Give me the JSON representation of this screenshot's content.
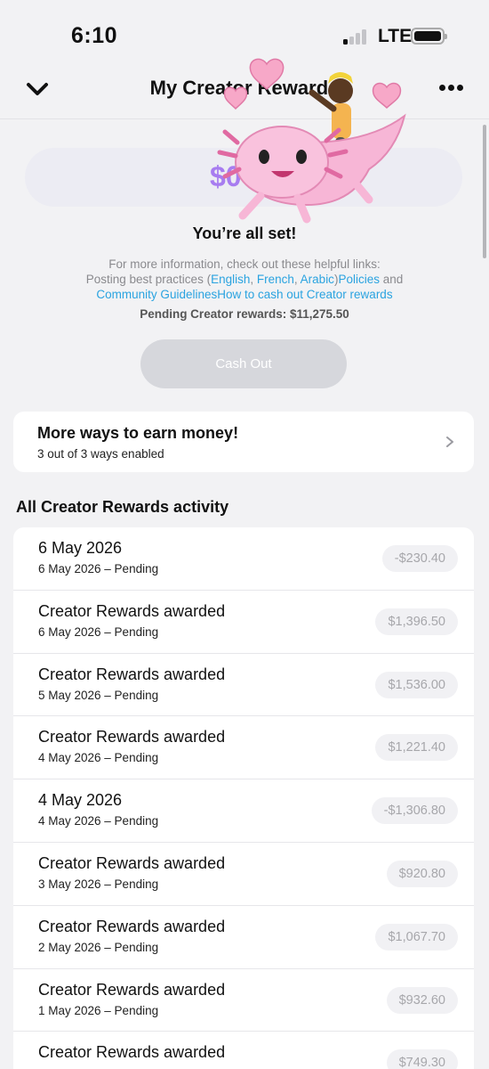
{
  "status_bar": {
    "time": "6:10",
    "network": "LTE"
  },
  "header": {
    "title": "My Creator Rewards"
  },
  "balance": {
    "value": "$0"
  },
  "status_message": "You’re all set!",
  "info": {
    "line1": "For more information, check out these helpful links:",
    "practices_prefix": "Posting best practices (",
    "link_english": "English",
    "sep1": ", ",
    "link_french": "French",
    "sep2": ", ",
    "link_arabic": "Arabic",
    "close_paren": ")",
    "link_policies": "Policies",
    "and_text": " and",
    "link_guidelines": "Community Guidelines",
    "link_cash_out": "How to cash out Creator rewards"
  },
  "pending_total": "Pending Creator rewards: $11,275.50",
  "cash_out_label": "Cash Out",
  "earn_card": {
    "title": "More ways to earn money!",
    "subtitle": "3 out of 3 ways enabled"
  },
  "activity": {
    "title": "All Creator Rewards activity",
    "items": [
      {
        "title": "6 May 2026",
        "subtitle": "6 May 2026 – Pending",
        "amount": "-$230.40"
      },
      {
        "title": "Creator Rewards awarded",
        "subtitle": "6 May 2026 – Pending",
        "amount": "$1,396.50"
      },
      {
        "title": "Creator Rewards awarded",
        "subtitle": "5 May 2026 – Pending",
        "amount": "$1,536.00"
      },
      {
        "title": "Creator Rewards awarded",
        "subtitle": "4 May 2026 – Pending",
        "amount": "$1,221.40"
      },
      {
        "title": "4 May 2026",
        "subtitle": "4 May 2026 – Pending",
        "amount": "-$1,306.80"
      },
      {
        "title": "Creator Rewards awarded",
        "subtitle": "3 May 2026 – Pending",
        "amount": "$920.80"
      },
      {
        "title": "Creator Rewards awarded",
        "subtitle": "2 May 2026 – Pending",
        "amount": "$1,067.70"
      },
      {
        "title": "Creator Rewards awarded",
        "subtitle": "1 May 2026 – Pending",
        "amount": "$932.60"
      },
      {
        "title": "Creator Rewards awarded",
        "subtitle": "",
        "amount": "$749.30"
      }
    ]
  },
  "colors": {
    "link": "#2aa3e0",
    "balance": "#a77cf0",
    "sticker_pink": "#f7b6d6"
  }
}
